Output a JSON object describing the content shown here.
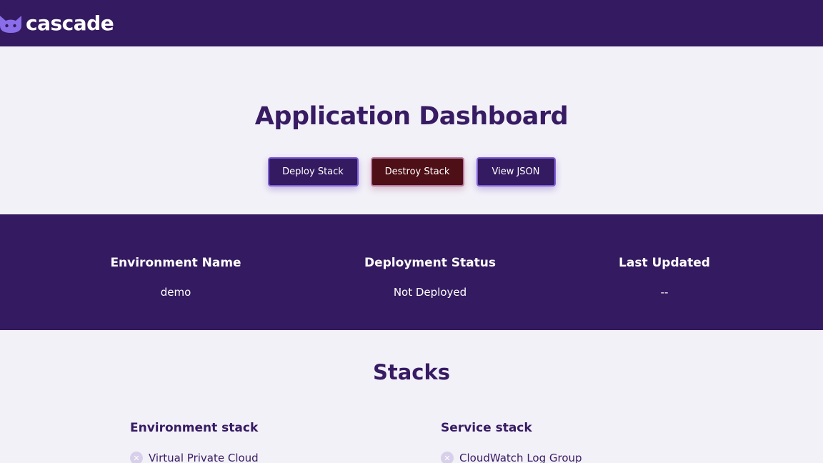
{
  "brand": {
    "name": "cascade",
    "icon": "cat-icon"
  },
  "page": {
    "title": "Application Dashboard"
  },
  "actions": {
    "deploy_label": "Deploy Stack",
    "destroy_label": "Destroy Stack",
    "view_json_label": "View JSON"
  },
  "environment": {
    "name_label": "Environment Name",
    "name_value": "demo",
    "status_label": "Deployment Status",
    "status_value": "Not Deployed",
    "updated_label": "Last Updated",
    "updated_value": "--"
  },
  "stacks": {
    "title": "Stacks",
    "environment_stack": {
      "heading": "Environment stack",
      "items": [
        {
          "label": "Virtual Private Cloud",
          "icon": "x-circle-icon"
        }
      ]
    },
    "service_stack": {
      "heading": "Service stack",
      "items": [
        {
          "label": "CloudWatch Log Group",
          "icon": "x-circle-icon"
        }
      ]
    }
  },
  "colors": {
    "primary": "#341a60",
    "background": "#f3f1f8",
    "destroy": "#4e0f16",
    "button_border": "#7c5fd6",
    "brand_icon": "#8a6de8"
  }
}
